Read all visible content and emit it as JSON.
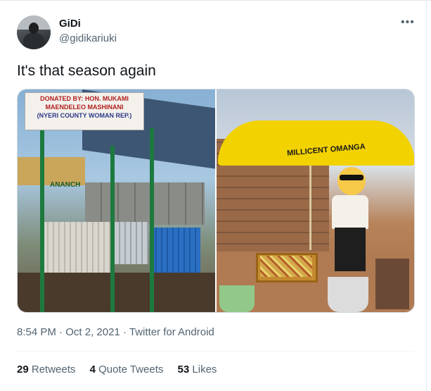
{
  "author": {
    "name": "GiDi",
    "handle": "@gidikariuki"
  },
  "tweet": {
    "text": "It's that season again",
    "time": "8:54 PM",
    "date": "Oct 2, 2021",
    "source": "Twitter for Android",
    "separator": "·"
  },
  "media": {
    "left_photo": {
      "sign_line1": "DONATED BY: HON. MUKAMI",
      "sign_line2": "MAENDELEO MASHINANI",
      "sign_line3": "(NYERI COUNTY WOMAN REP.)",
      "building_text": "ANANCH"
    },
    "right_photo": {
      "umbrella_text": "MILLICENT OMANGA"
    }
  },
  "stats": {
    "retweets_count": "29",
    "retweets_label": "Retweets",
    "quotes_count": "4",
    "quotes_label": "Quote Tweets",
    "likes_count": "53",
    "likes_label": "Likes"
  },
  "icons": {
    "more": "more-horizontal-icon"
  },
  "colors": {
    "text": "#0f1419",
    "secondary": "#536471",
    "border": "#cfd9de"
  }
}
